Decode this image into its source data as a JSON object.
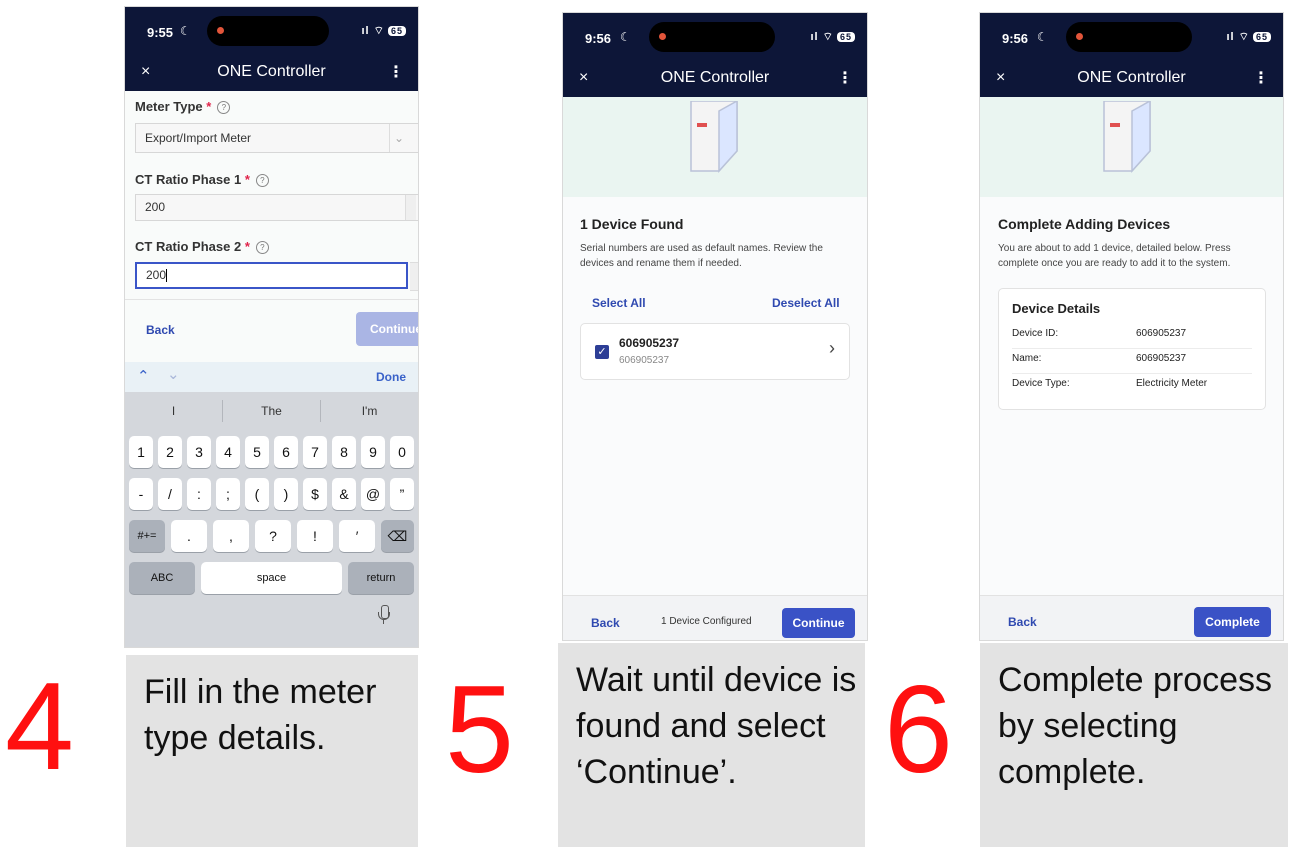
{
  "phone_common": {
    "app_title": "ONE Controller",
    "close_icon": "×",
    "menu_icon": "⋮",
    "signal_text": "ıl ⌔",
    "battery": "65"
  },
  "panel1": {
    "time": "9:55",
    "meter_type_label": "Meter Type",
    "meter_type_value": "Export/Import Meter",
    "ct1_label": "CT Ratio Phase 1",
    "ct1_value": "200",
    "ct2_label": "CT Ratio Phase 2",
    "ct2_value": "200",
    "required_mark": "*",
    "back_label": "Back",
    "continue_label": "Continue",
    "done_label": "Done",
    "suggestions": [
      "I",
      "The",
      "I'm"
    ],
    "keys_row1": [
      "1",
      "2",
      "3",
      "4",
      "5",
      "6",
      "7",
      "8",
      "9",
      "0"
    ],
    "keys_row2": [
      "-",
      "/",
      ":",
      ";",
      "(",
      ")",
      "$",
      "&",
      "@",
      "”"
    ],
    "key_symbols": "#+=",
    "keys_row3": [
      ".",
      ",",
      "?",
      "!",
      "′"
    ],
    "key_abc": "ABC",
    "key_space": "space",
    "key_return": "return"
  },
  "panel2": {
    "time": "9:56",
    "heading": "1 Device Found",
    "description": "Serial numbers are used as default names. Review the devices and rename them if needed.",
    "select_all": "Select All",
    "deselect_all": "Deselect All",
    "device_name": "606905237",
    "device_serial": "606905237",
    "back_label": "Back",
    "configured_text": "1 Device Configured",
    "continue_label": "Continue"
  },
  "panel3": {
    "time": "9:56",
    "heading": "Complete Adding Devices",
    "description": "You are about to add 1 device, detailed below. Press complete once you are ready to add it to the system.",
    "details_title": "Device Details",
    "rows": [
      {
        "label": "Device ID:",
        "value": "606905237"
      },
      {
        "label": "Name:",
        "value": "606905237"
      },
      {
        "label": "Device Type:",
        "value": "Electricity Meter"
      }
    ],
    "back_label": "Back",
    "complete_label": "Complete"
  },
  "captions": [
    {
      "number": "4",
      "text": "Fill in the meter type details."
    },
    {
      "number": "5",
      "text": "Wait until device is found and select ‘Continue’."
    },
    {
      "number": "6",
      "text": "Complete process by selecting complete."
    }
  ],
  "colors": {
    "header_navy": "#0d1638",
    "primary_button": "#3a52c6",
    "disabled_button": "#aab5e4",
    "accent_red": "#ff1010",
    "caption_bg": "#e3e3e3"
  }
}
